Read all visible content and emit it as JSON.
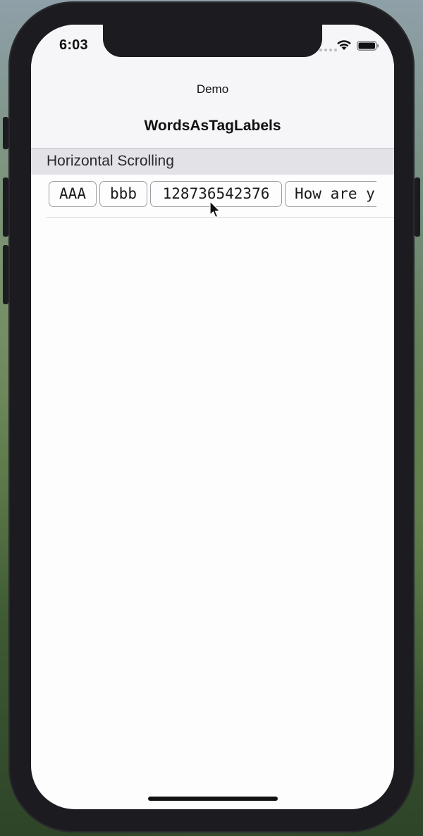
{
  "status_bar": {
    "time": "6:03"
  },
  "nav": {
    "back_title": "Demo",
    "title": "WordsAsTagLabels"
  },
  "section": {
    "title": "Horizontal Scrolling"
  },
  "tags": [
    {
      "label": "AAA"
    },
    {
      "label": "bbb"
    },
    {
      "label": "128736542376"
    },
    {
      "label": "How are y"
    }
  ],
  "colors": {
    "tag_border": "#9c9ba1",
    "section_header_bg": "#e3e2e6",
    "nav_bg": "#f6f5f7"
  },
  "icons": {
    "wifi": "wifi-icon",
    "battery": "battery-icon",
    "cursor": "cursor-icon"
  }
}
